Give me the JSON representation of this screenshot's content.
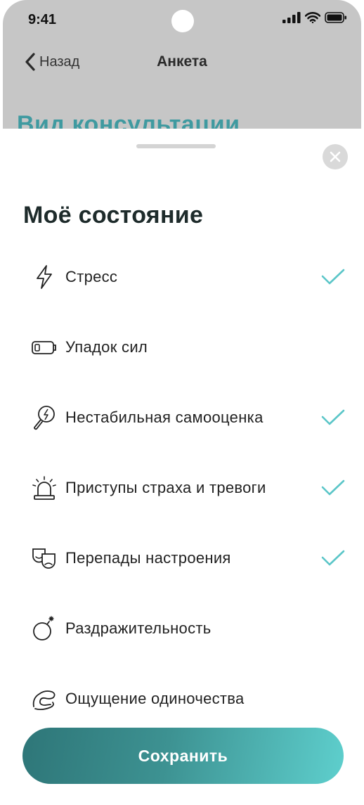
{
  "status_bar": {
    "time": "9:41"
  },
  "nav": {
    "back_label": "Назад",
    "title": "Анкета"
  },
  "background": {
    "heading": "Вид консультации"
  },
  "sheet": {
    "title": "Моё состояние",
    "options": [
      {
        "label": "Стресс",
        "icon": "lightning-icon",
        "checked": true
      },
      {
        "label": "Упадок сил",
        "icon": "low-battery-icon",
        "checked": false
      },
      {
        "label": "Нестабильная самооценка",
        "icon": "mirror-icon",
        "checked": true
      },
      {
        "label": "Приступы страха и тревоги",
        "icon": "alarm-siren-icon",
        "checked": true
      },
      {
        "label": "Перепады настроения",
        "icon": "theater-masks-icon",
        "checked": true
      },
      {
        "label": "Раздражительность",
        "icon": "bomb-icon",
        "checked": false
      },
      {
        "label": "Ощущение одиночества",
        "icon": "hugging-hands-icon",
        "checked": false
      }
    ],
    "save_label": "Сохранить"
  },
  "colors": {
    "accent": "#5ecfcd",
    "check": "#5bc6c8",
    "button_start": "#2e7678",
    "button_end": "#5ecfcd",
    "heading_teal": "#3f9aa0"
  }
}
